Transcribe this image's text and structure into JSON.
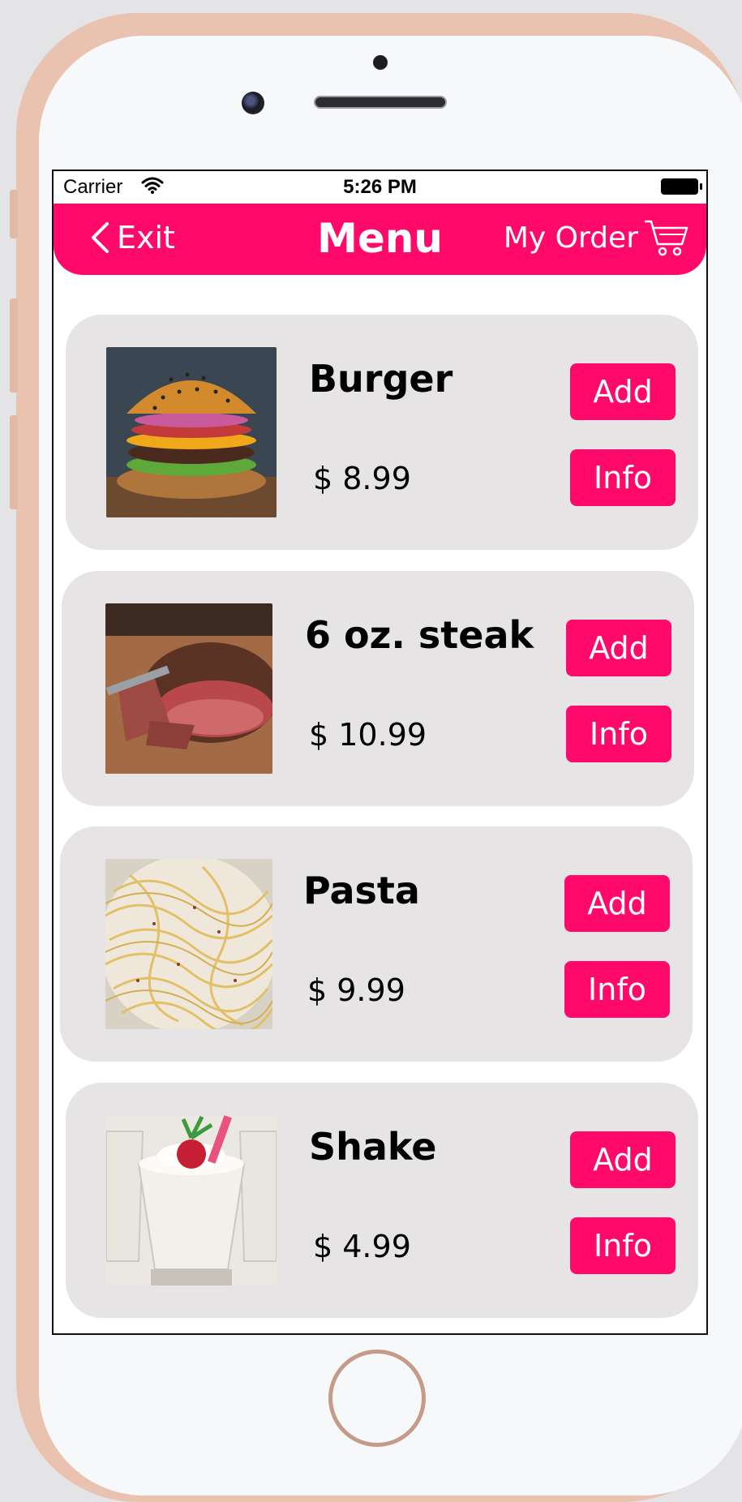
{
  "status_bar": {
    "carrier": "Carrier",
    "time": "5:26 PM"
  },
  "navbar": {
    "exit_label": "Exit",
    "title": "Menu",
    "order_label": "My Order",
    "accent_color": "#ff0a6b"
  },
  "menu": {
    "items": [
      {
        "name": "Burger",
        "price": "$ 8.99",
        "add_label": "Add",
        "info_label": "Info",
        "image": "burger-photo"
      },
      {
        "name": "6 oz. steak",
        "price": "$ 10.99",
        "add_label": "Add",
        "info_label": "Info",
        "image": "steak-photo"
      },
      {
        "name": "Pasta",
        "price": "$ 9.99",
        "add_label": "Add",
        "info_label": "Info",
        "image": "pasta-photo"
      },
      {
        "name": "Shake",
        "price": "$ 4.99",
        "add_label": "Add",
        "info_label": "Info",
        "image": "shake-photo"
      }
    ]
  }
}
